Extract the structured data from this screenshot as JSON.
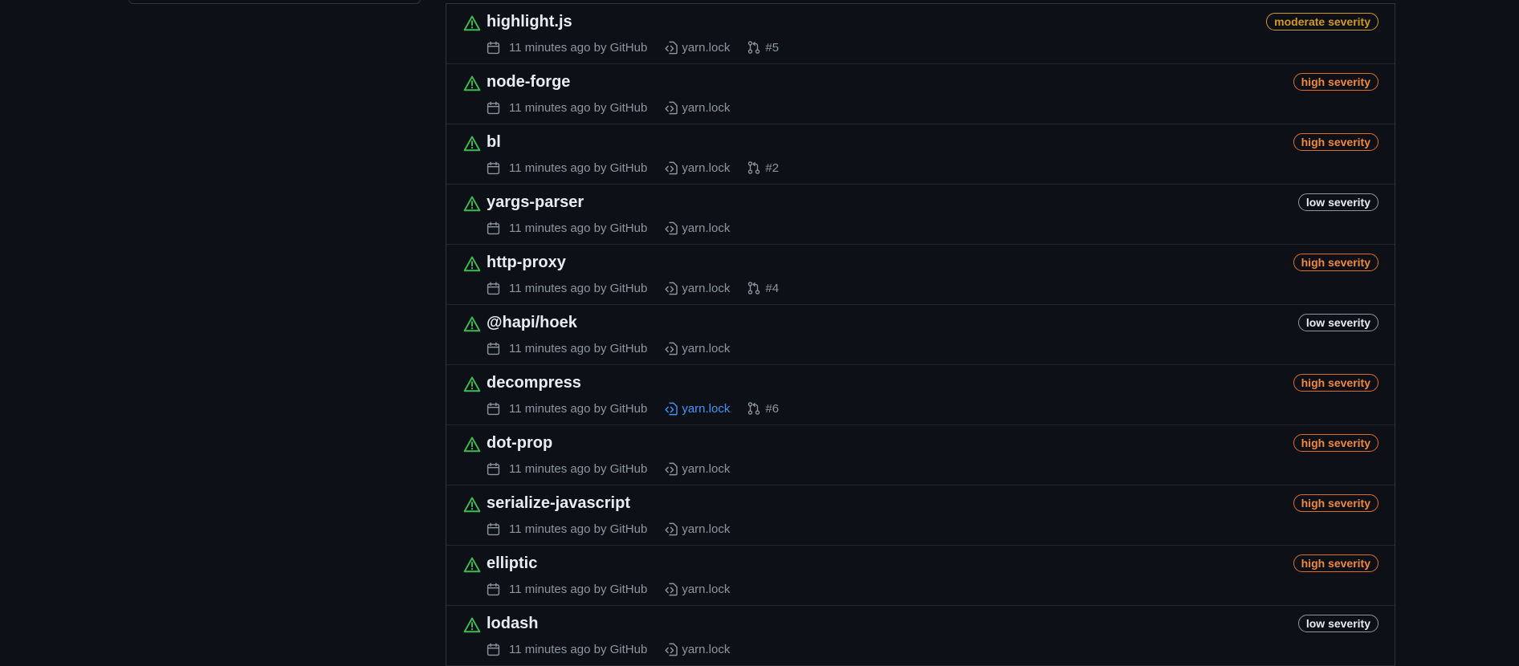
{
  "colors": {
    "background": "#0d1117",
    "border": "#30363d",
    "alert_icon": "#3fb950",
    "moderate": "#d29922",
    "high": "#f0883e",
    "low": "#e6edf3",
    "link": "#4493f8"
  },
  "alerts": [
    {
      "name": "highlight.js",
      "time": "11 minutes ago by GitHub",
      "file": "yarn.lock",
      "file_link": false,
      "pr": "#5",
      "severity": "moderate severity",
      "level": "moderate",
      "icon": "alert-icon"
    },
    {
      "name": "node-forge",
      "time": "11 minutes ago by GitHub",
      "file": "yarn.lock",
      "file_link": false,
      "pr": "",
      "severity": "high severity",
      "level": "high",
      "icon": "alert-icon"
    },
    {
      "name": "bl",
      "time": "11 minutes ago by GitHub",
      "file": "yarn.lock",
      "file_link": false,
      "pr": "#2",
      "severity": "high severity",
      "level": "high",
      "icon": "alert-icon"
    },
    {
      "name": "yargs-parser",
      "time": "11 minutes ago by GitHub",
      "file": "yarn.lock",
      "file_link": false,
      "pr": "",
      "severity": "low severity",
      "level": "low",
      "icon": "alert-icon"
    },
    {
      "name": "http-proxy",
      "time": "11 minutes ago by GitHub",
      "file": "yarn.lock",
      "file_link": false,
      "pr": "#4",
      "severity": "high severity",
      "level": "high",
      "icon": "alert-icon"
    },
    {
      "name": "@hapi/hoek",
      "time": "11 minutes ago by GitHub",
      "file": "yarn.lock",
      "file_link": false,
      "pr": "",
      "severity": "low severity",
      "level": "low",
      "icon": "alert-icon"
    },
    {
      "name": "decompress",
      "time": "11 minutes ago by GitHub",
      "file": "yarn.lock",
      "file_link": true,
      "pr": "#6",
      "severity": "high severity",
      "level": "high",
      "icon": "alert-icon"
    },
    {
      "name": "dot-prop",
      "time": "11 minutes ago by GitHub",
      "file": "yarn.lock",
      "file_link": false,
      "pr": "",
      "severity": "high severity",
      "level": "high",
      "icon": "alert-icon"
    },
    {
      "name": "serialize-javascript",
      "time": "11 minutes ago by GitHub",
      "file": "yarn.lock",
      "file_link": false,
      "pr": "",
      "severity": "high severity",
      "level": "high",
      "icon": "alert-icon"
    },
    {
      "name": "elliptic",
      "time": "11 minutes ago by GitHub",
      "file": "yarn.lock",
      "file_link": false,
      "pr": "",
      "severity": "high severity",
      "level": "high",
      "icon": "alert-icon"
    },
    {
      "name": "lodash",
      "time": "11 minutes ago by GitHub",
      "file": "yarn.lock",
      "file_link": false,
      "pr": "",
      "severity": "low severity",
      "level": "low",
      "icon": "alert-icon"
    }
  ]
}
